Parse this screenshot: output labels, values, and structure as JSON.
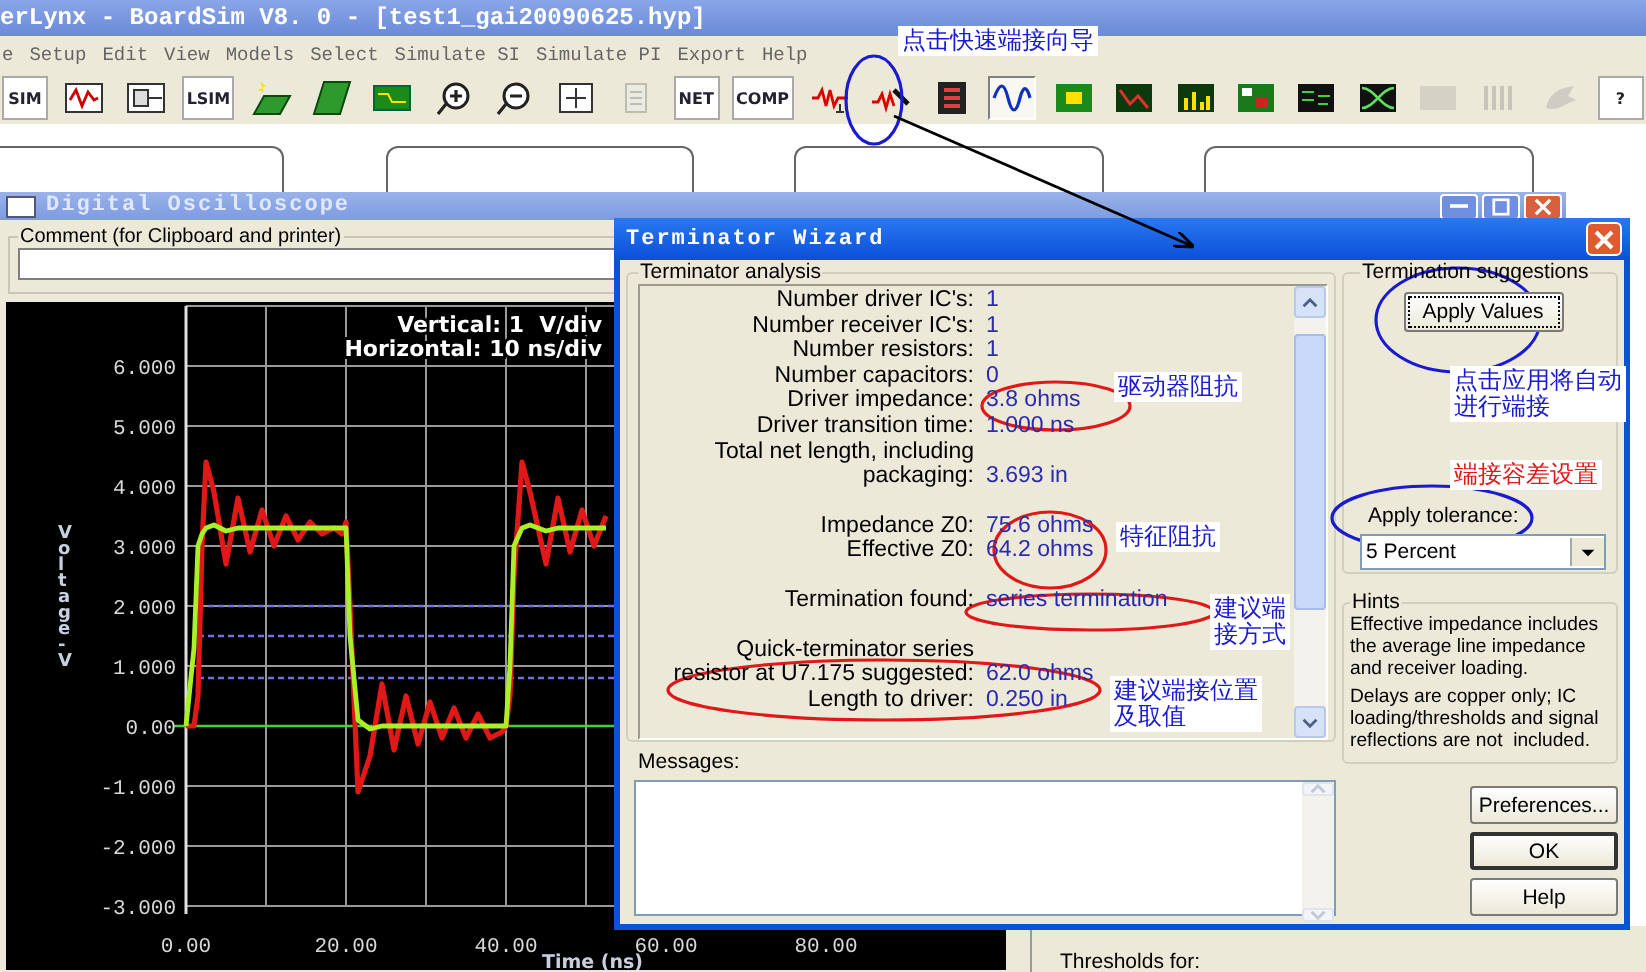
{
  "app": {
    "title": "erLynx - BoardSim V8. 0 - [test1_gai20090625.hyp]"
  },
  "menu": [
    "e",
    "Setup",
    "Edit",
    "View",
    "Models",
    "Select",
    "Simulate SI",
    "Simulate PI",
    "Export",
    "Help"
  ],
  "toolbar": [
    {
      "kind": "text",
      "label": "SIM",
      "selected": false,
      "disabled": false
    },
    {
      "kind": "icon",
      "selected": false,
      "disabled": false
    },
    {
      "kind": "icon",
      "selected": false,
      "disabled": false
    },
    {
      "kind": "text",
      "label": "LSIM",
      "selected": false,
      "disabled": false
    },
    {
      "kind": "icon",
      "selected": false,
      "disabled": false
    },
    {
      "kind": "icon",
      "selected": false,
      "disabled": false
    },
    {
      "kind": "icon",
      "selected": false,
      "disabled": false
    },
    {
      "kind": "icon",
      "selected": false,
      "disabled": false
    },
    {
      "kind": "icon",
      "selected": false,
      "disabled": false
    },
    {
      "kind": "icon",
      "selected": false,
      "disabled": false
    },
    {
      "kind": "icon",
      "selected": false,
      "disabled": true
    },
    {
      "kind": "text",
      "label": "NET",
      "selected": false,
      "disabled": false
    },
    {
      "kind": "text",
      "label": "COMP",
      "selected": false,
      "disabled": false
    },
    {
      "kind": "icon",
      "selected": false,
      "disabled": false
    },
    {
      "kind": "icon",
      "selected": false,
      "disabled": false
    },
    {
      "kind": "icon",
      "selected": false,
      "disabled": false
    },
    {
      "kind": "icon",
      "selected": true,
      "disabled": false
    },
    {
      "kind": "icon",
      "selected": false,
      "disabled": false
    },
    {
      "kind": "icon",
      "selected": false,
      "disabled": false
    },
    {
      "kind": "icon",
      "selected": false,
      "disabled": false
    },
    {
      "kind": "icon",
      "selected": false,
      "disabled": false
    },
    {
      "kind": "icon",
      "selected": false,
      "disabled": false
    },
    {
      "kind": "icon",
      "selected": false,
      "disabled": false
    },
    {
      "kind": "icon",
      "selected": false,
      "disabled": true
    },
    {
      "kind": "icon",
      "selected": false,
      "disabled": true
    },
    {
      "kind": "icon",
      "selected": false,
      "disabled": true
    },
    {
      "kind": "text",
      "label": "?",
      "selected": false,
      "disabled": false
    }
  ],
  "scope": {
    "title": "Digital Oscilloscope",
    "comment_label": "Comment (for Clipboard and printer)",
    "scale": [
      "Vertical: 1  V/div",
      "Horizontal: 10 ns/div"
    ],
    "chart_data": {
      "type": "line",
      "xlabel": "Time (ns)",
      "ylabel": "Voltage-V",
      "x": [
        0,
        1,
        1.5,
        2,
        2.5,
        3.5,
        5,
        6.5,
        8,
        9.5,
        11,
        12.5,
        14,
        15.5,
        17,
        18.5,
        19.5,
        20,
        20.5,
        21.5,
        23,
        24.5,
        26,
        27.5,
        29,
        30.5,
        32,
        33.5,
        35,
        36.5,
        38,
        39.5,
        40,
        40.5,
        41,
        42,
        43,
        45,
        46.5,
        48,
        49.5,
        51,
        52.5
      ],
      "series": [
        {
          "color": "#e01818",
          "values": [
            0,
            0,
            0.5,
            3.0,
            4.4,
            3.9,
            2.7,
            3.8,
            2.9,
            3.6,
            3.0,
            3.5,
            3.1,
            3.4,
            3.2,
            3.3,
            3.2,
            3.4,
            2.0,
            -1.1,
            -0.5,
            0.7,
            -0.4,
            0.5,
            -0.3,
            0.4,
            -0.2,
            0.3,
            -0.2,
            0.2,
            -0.2,
            -0.1,
            0,
            0.5,
            2.5,
            4.4,
            3.9,
            2.7,
            3.8,
            2.9,
            3.6,
            3.0,
            3.5
          ]
        },
        {
          "color": "#a8f028",
          "values": [
            0,
            1.3,
            3.0,
            3.2,
            3.3,
            3.35,
            3.25,
            3.3,
            3.3,
            3.3,
            3.3,
            3.3,
            3.3,
            3.3,
            3.3,
            3.3,
            3.3,
            3.3,
            1.5,
            0.1,
            -0.05,
            0,
            0,
            0,
            0,
            0,
            0,
            0,
            0,
            0,
            0,
            0,
            0,
            1.0,
            3.0,
            3.3,
            3.35,
            3.25,
            3.3,
            3.3,
            3.3,
            3.3,
            3.3
          ]
        }
      ],
      "xlim": [
        0,
        100
      ],
      "ylim": [
        -3,
        7
      ],
      "grid": true,
      "xticks": [
        {
          "value": 0,
          "label": "0.00"
        },
        {
          "value": 20,
          "label": "20.00"
        },
        {
          "value": 40,
          "label": "40.00"
        },
        {
          "value": 60,
          "label": "60.00"
        },
        {
          "value": 80,
          "label": "80.00"
        }
      ],
      "yticks": [
        {
          "value": 6,
          "label": "6.000"
        },
        {
          "value": 5,
          "label": "5.000"
        },
        {
          "value": 4,
          "label": "4.000"
        },
        {
          "value": 3,
          "label": "3.000"
        },
        {
          "value": 2,
          "label": "2.000"
        },
        {
          "value": 1,
          "label": "1.000"
        },
        {
          "value": 0,
          "label": "0.00"
        },
        {
          "value": -1,
          "label": "-1.000"
        },
        {
          "value": -2,
          "label": "-2.000"
        },
        {
          "value": -3,
          "label": "-3.000"
        }
      ],
      "ref_lines": [
        {
          "axis": "y",
          "value": 0,
          "color": "#40d040"
        },
        {
          "axis": "y",
          "value": 2.0,
          "color": "#7070e0"
        },
        {
          "axis": "y",
          "value": 1.5,
          "color": "#7070e0"
        },
        {
          "axis": "y",
          "value": 0.8,
          "color": "#7070e0"
        }
      ]
    }
  },
  "thresholds": {
    "label": "Thresholds for:"
  },
  "wizard": {
    "title": "Terminator Wizard",
    "analysis": {
      "legend": "Terminator analysis",
      "sections": [
        [
          {
            "label": [
              "Number driver IC's:"
            ],
            "value": "1"
          },
          {
            "label": [
              "Number receiver IC's:"
            ],
            "value": "1"
          },
          {
            "label": [
              "Number resistors:"
            ],
            "value": "1"
          },
          {
            "label": [
              "Number capacitors:"
            ],
            "value": "0"
          },
          {
            "label": [
              "Driver impedance:"
            ],
            "value": "3.8 ohms"
          },
          {
            "label": [
              "Driver transition time:"
            ],
            "value": "1.000 ns"
          },
          {
            "label": [
              "Total net length, including",
              "packaging:"
            ],
            "value": "3.693 in"
          }
        ],
        [
          {
            "label": [
              "Impedance Z0:"
            ],
            "value": "75.6 ohms"
          },
          {
            "label": [
              "Effective Z0:"
            ],
            "value": "64.2 ohms"
          }
        ],
        [
          {
            "label": [
              "Termination found:"
            ],
            "value": "series termination"
          }
        ],
        [
          {
            "label": [
              "Quick-terminator series",
              "resistor at U7.175 suggested:"
            ],
            "value": "62.0 ohms"
          },
          {
            "label": [
              "Length to driver:"
            ],
            "value": "0.250 in"
          }
        ]
      ]
    },
    "messages_label": "Messages:",
    "suggestions": {
      "legend": "Termination suggestions",
      "apply_button": "Apply Values",
      "tolerance_label": "Apply tolerance:",
      "tolerance_value": "5 Percent"
    },
    "hints": {
      "legend": "Hints",
      "paragraphs": [
        "Effective impedance includes the average line impedance and receiver loading.",
        "Delays are copper only; IC loading/thresholds and signal reflections are not  included."
      ]
    },
    "buttons": [
      {
        "label": "Preferences...",
        "default": false
      },
      {
        "label": "OK",
        "default": true
      },
      {
        "label": "Help",
        "default": false
      }
    ]
  },
  "notes": [
    {
      "text": "点击快速端接向导",
      "color": "#1a1ad0"
    },
    {
      "text": "驱动器阻抗",
      "color": "#1a1ad0"
    },
    {
      "text": "特征阻抗",
      "color": "#1a1ad0"
    },
    {
      "text": "建议端接方式",
      "color": "#1a1ad0"
    },
    {
      "text": "建议端接位置及取值",
      "color": "#1a1ad0"
    },
    {
      "text": "点击应用将自动进行端接",
      "color": "#1a1ad0"
    },
    {
      "text": "端接容差设置",
      "color": "#e01818"
    }
  ]
}
